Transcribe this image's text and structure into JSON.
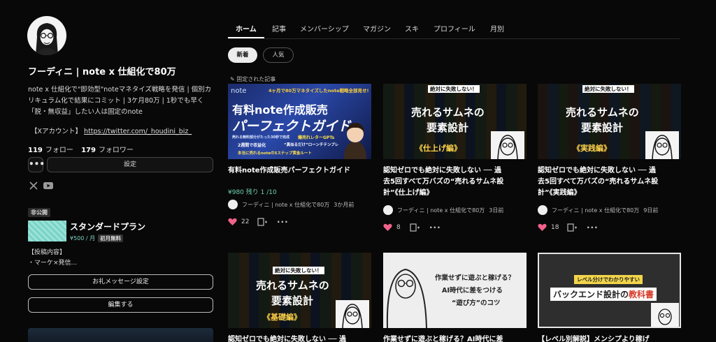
{
  "profile": {
    "name": "フーディニ | note x 仕組化で80万",
    "bio_lines": [
      "note x 仕組化で\"即効型\"noteマネタイズ戦略を発信 | 個別カ",
      "リキュラム化で結果にコミット | 3ケ月80万 | 1秒でも早く",
      "「脱・無収益」したい人は固定のnote"
    ],
    "twitter_label": "【Xアカウント】",
    "twitter_url": "https://twitter.com/_houdini_biz_",
    "follow_count": "119",
    "follow_label": "フォロー",
    "follower_count": "179",
    "follower_label": "フォロワー",
    "more_label": "•••",
    "settings_label": "設定"
  },
  "membership": {
    "badge": "非公開",
    "plan_name": "スタンダードプラン",
    "price": "¥500 / 月",
    "trial_badge": "初月無料",
    "desc_lines": [
      "【投稿内容】",
      "・マーケ×発信..."
    ],
    "thanks_button": "お礼メッセージ設定",
    "edit_button": "編集する"
  },
  "tabs": [
    "ホーム",
    "記事",
    "メンバーシップ",
    "マガジン",
    "スキ",
    "プロフィール",
    "月別"
  ],
  "filters": {
    "new": "新着",
    "popular": "人気"
  },
  "pinned_label": "固定された記事",
  "cards": [
    {
      "title_lines": [
        "有料note作成販売パーフェクトガイド"
      ],
      "price": "¥980  残り 1 /10",
      "author": "フーディニ | note x 仕組化で80万",
      "ago": "3か月前",
      "likes": "22",
      "thumb": {
        "top_line": "4ヶ月で80万マネタイズしたnote戦略全部見せ!",
        "main1": "有料note作成販売",
        "main2": "パーフェクトガイド",
        "sub1": "売れる無料部分がたった30秒で完成",
        "sub2": "爆売れレターGPTs",
        "sub3": "2週間で収益化",
        "sub4": "“真似るだけ”ローンチテンプレ",
        "sub5": "本当に売れるnoteの5ステップ黄金ルート"
      }
    },
    {
      "title_lines": [
        "認知ゼロでも絶対に失敗しない ── 過",
        "去5回すべて万バズの“売れるサムネ設",
        "計”《仕上げ編》"
      ],
      "author": "フーディニ | note x 仕組化で80万",
      "ago": "3日前",
      "likes": "8",
      "thumb": {
        "badge": "絶対に失敗しない！",
        "line1": "売れるサムネの",
        "line2": "要素設計",
        "line3": "《仕上げ編》"
      }
    },
    {
      "title_lines": [
        "認知ゼロでも絶対に失敗しない ── 過",
        "去5回すべて万バズの“売れるサムネ設",
        "計”《実践編》"
      ],
      "author": "フーディニ | note x 仕組化で80万",
      "ago": "9日前",
      "likes": "18",
      "thumb": {
        "badge": "絶対に失敗しない！",
        "line1": "売れるサムネの",
        "line2": "要素設計",
        "line3": "《実践編》"
      }
    },
    {
      "title_lines": [
        "認知ゼロでも絶対に失敗しない ── 過"
      ],
      "thumb": {
        "badge": "絶対に失敗しない！",
        "line1": "売れるサムネの",
        "line2": "要素設計",
        "line3": "《基礎編》"
      }
    },
    {
      "title_lines": [
        "作業せずに遊ぶと稼げる？AI時代に差"
      ],
      "thumb": {
        "line1": "作業せずに遊ぶと稼げる？",
        "line2": "AI時代に差をつける",
        "line3": "“遊び方”のコツ"
      }
    },
    {
      "title_lines": [
        "【レベル別解説】メンシプより稼げ"
      ],
      "thumb": {
        "badge": "レベル分けでわかりやすい",
        "line1": "バックエンド設計の",
        "line2": "教科書"
      }
    }
  ]
}
